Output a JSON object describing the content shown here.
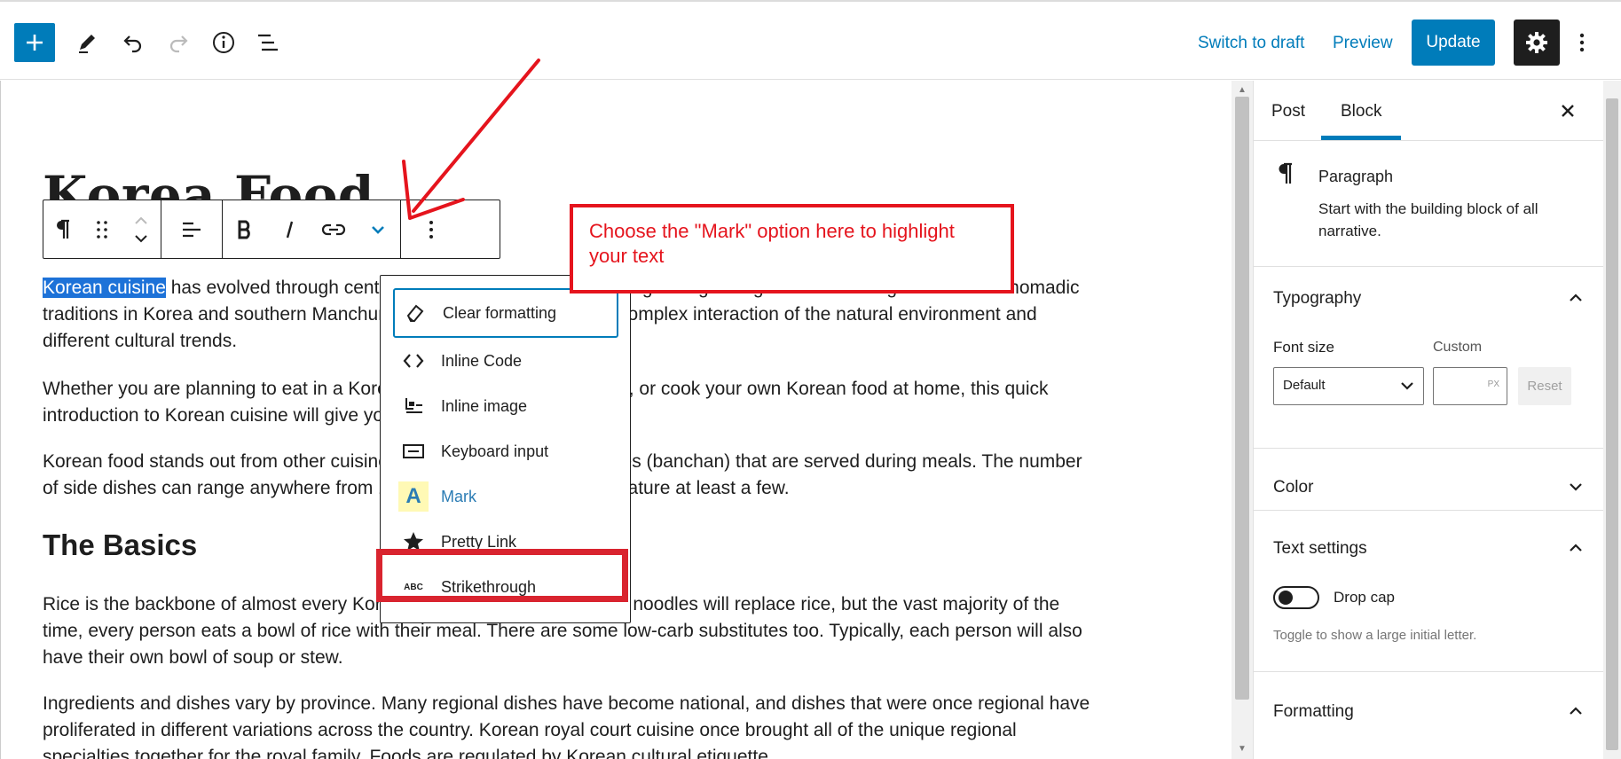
{
  "toolbar": {
    "switch_to_draft": "Switch to draft",
    "preview": "Preview",
    "update": "Update",
    "icons": [
      "plus-icon",
      "pencil-icon",
      "undo-icon",
      "redo-icon",
      "info-icon",
      "list-view-icon",
      "gear-icon",
      "more-vertical-icon"
    ]
  },
  "editor": {
    "title": "Korea Food",
    "p1_selected": "Korean cuisine",
    "p1_rest": " has evolved through centuries of social and political change. Originating from ancient agricultural and nomadic traditions in Korea and southern Manchuria, Korean cuisine reflects a complex interaction of the natural environment and different cultural trends.",
    "p2": "Whether you are planning to eat in a Korean restaurant, travel to Korea, or cook your own Korean food at home, this quick introduction to Korean cuisine will give you a good head start.",
    "p3": "Korean food stands out from other cuisines by the number of side dishes (banchan) that are served during meals. The number of side dishes can range anywhere from 1 to 12, but everyday meals feature at least a few.",
    "h2": "The Basics",
    "p4": "Rice is the backbone of almost every Korean meal. In some occasions, noodles will replace rice, but the vast majority of the time, every person eats a bowl of rice with their meal. There are some low-carb substitutes too. Typically, each person will also have their own bowl of soup or stew.",
    "p5": "Ingredients and dishes vary by province. Many regional dishes have become national, and dishes that were once regional have proliferated in different variations across the country. Korean royal court cuisine once brought all of the unique regional specialties together for the royal family. Foods are regulated by Korean cultural etiquette."
  },
  "format_menu": {
    "items": [
      {
        "label": "Clear formatting",
        "icon": "eraser-icon"
      },
      {
        "label": "Inline Code",
        "icon": "code-icon"
      },
      {
        "label": "Inline image",
        "icon": "image-icon"
      },
      {
        "label": "Keyboard input",
        "icon": "keyboard-icon"
      },
      {
        "label": "Mark",
        "icon": "mark-icon",
        "glyph": "A"
      },
      {
        "label": "Pretty Link",
        "icon": "star-icon"
      },
      {
        "label": "Strikethrough",
        "icon": "strikethrough-icon",
        "glyph": "ABC"
      }
    ]
  },
  "annotation": {
    "text": "Choose the \"Mark\" option here to highlight your text",
    "color": "#e5141d"
  },
  "sidebar": {
    "tab_post": "Post",
    "tab_block": "Block",
    "block_name": "Paragraph",
    "block_desc": "Start with the building block of all narrative.",
    "typography": "Typography",
    "font_size_label": "Font size",
    "custom_label": "Custom",
    "font_size_value": "Default",
    "custom_unit": "PX",
    "reset": "Reset",
    "color": "Color",
    "text_settings": "Text settings",
    "drop_cap": "Drop cap",
    "drop_cap_help": "Toggle to show a large initial letter.",
    "formatting": "Formatting"
  },
  "colors": {
    "accent": "#007cba",
    "selection": "#1d72d8",
    "highlight_box": "#d9242f",
    "mark_bg": "#fff9b5"
  }
}
